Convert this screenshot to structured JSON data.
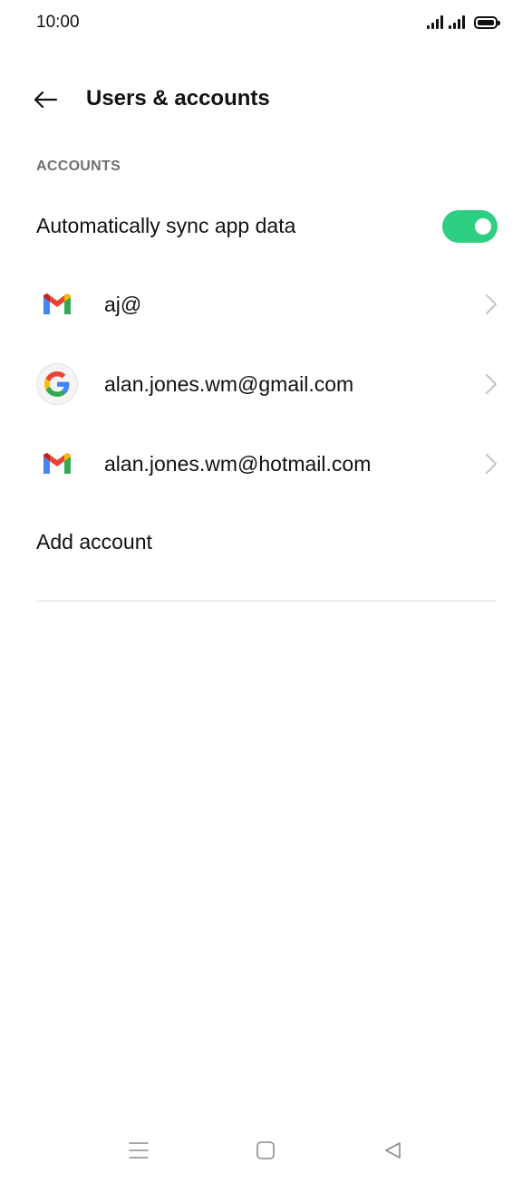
{
  "status_bar": {
    "time": "10:00",
    "icons": [
      "signal-icon",
      "signal-icon",
      "battery-icon"
    ]
  },
  "header": {
    "back_icon": "arrow-left-icon",
    "title": "Users & accounts"
  },
  "section": {
    "label": "ACCOUNTS"
  },
  "sync": {
    "label": "Automatically sync app data",
    "enabled": true,
    "toggle_color": "#2ecf82"
  },
  "accounts": [
    {
      "icon": "gmail-icon",
      "email": "aj@"
    },
    {
      "icon": "google-icon",
      "email": "alan.jones.wm@gmail.com"
    },
    {
      "icon": "gmail-icon",
      "email": "alan.jones.wm@hotmail.com"
    }
  ],
  "add_account": {
    "label": "Add account"
  },
  "nav_bar": {
    "buttons": [
      "menu-icon",
      "home-icon",
      "back-triangle-icon"
    ]
  }
}
